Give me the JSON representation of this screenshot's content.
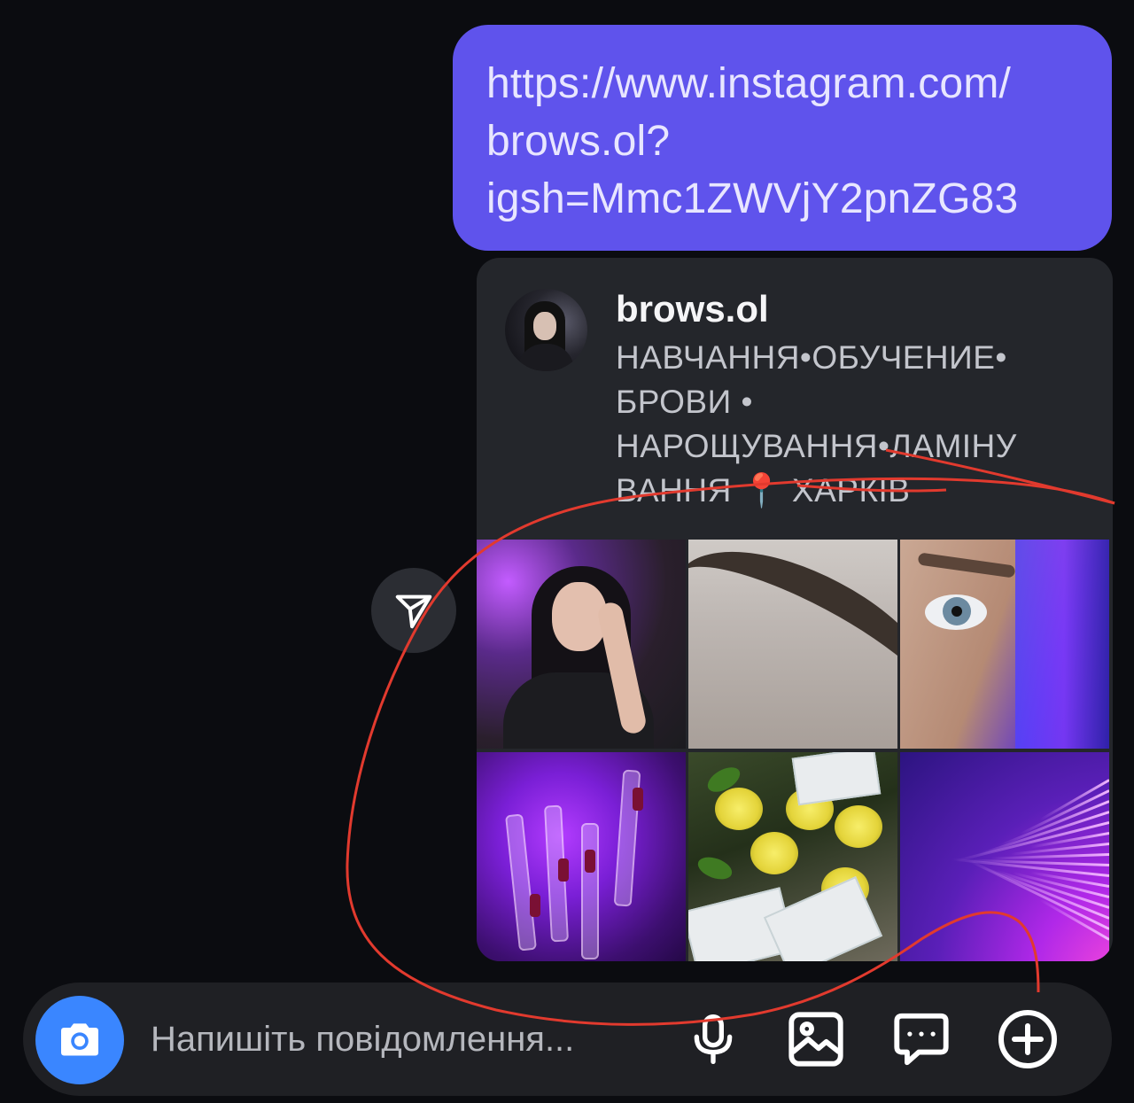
{
  "message": {
    "link_lines": [
      "https://www.instagram.com/",
      "brows.ol?",
      "igsh=Mmc1ZWVjY2pnZG83"
    ]
  },
  "preview": {
    "username": "brows.ol",
    "bio_lines": [
      "НАВЧАННЯ•ОБУЧЕНИЕ•",
      "БРОВИ •",
      "НАРОЩУВАННЯ•ЛАМІНУ",
      "ВАННЯ 📍 ХАРКІВ"
    ]
  },
  "composer": {
    "placeholder": "Напишіть повідомлення..."
  },
  "colors": {
    "background": "#0b0c10",
    "sent_bubble": "#5f53ec",
    "card": "#24262b",
    "camera_button": "#3a86ff",
    "annotation_stroke": "#e23a2e"
  },
  "icons": [
    "paper-plane-icon",
    "camera-icon",
    "microphone-icon",
    "image-icon",
    "sticker-chat-icon",
    "plus-circle-icon"
  ]
}
